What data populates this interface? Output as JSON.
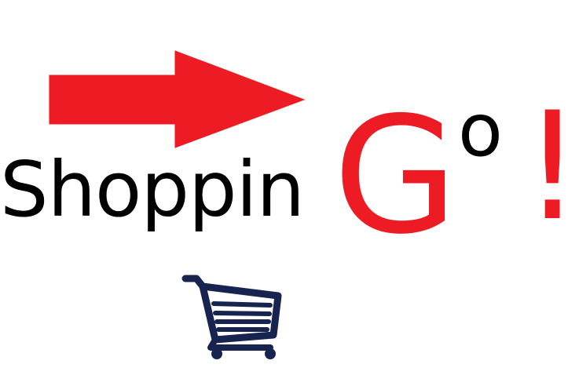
{
  "logo": {
    "text_prefix": "Shoppin",
    "text_big_letter": "G",
    "text_superscript": "o",
    "text_exclamation": "!",
    "icons": {
      "arrow": "arrow-right-icon",
      "cart": "shopping-cart-icon"
    },
    "colors": {
      "accent": "#ed1c24",
      "text": "#000000",
      "cart": "#17244f"
    }
  }
}
